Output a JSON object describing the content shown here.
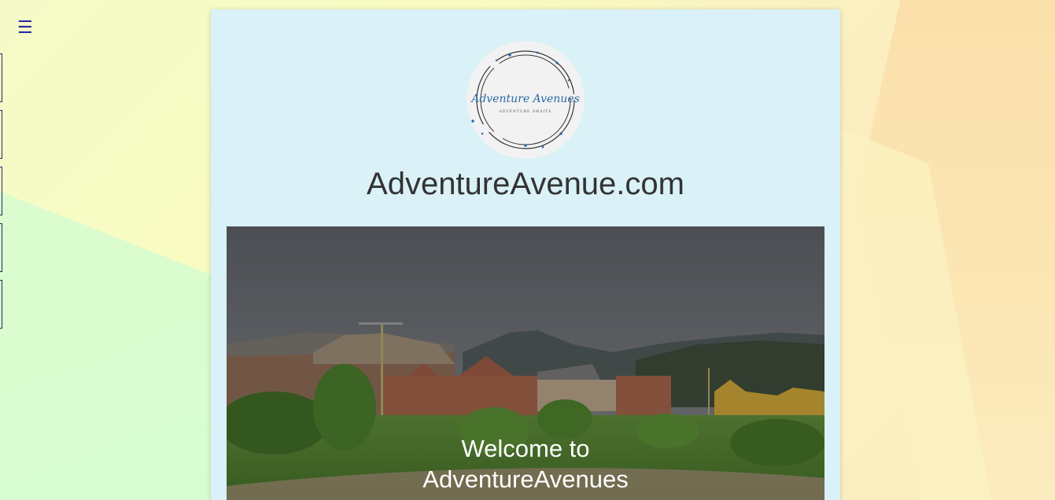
{
  "nav": {
    "menu_icon": "hamburger-icon",
    "menu_glyph": "☰",
    "slot_count": 5
  },
  "brand": {
    "logo_script_text": "Adventure Avenues",
    "logo_tagline": "ADVENTURE AWAITS",
    "site_title": "AdventureAvenue.com"
  },
  "hero": {
    "title_line1": "Welcome to",
    "title_line2": "AdventureAvenues"
  },
  "colors": {
    "accent": "#2a2aa0",
    "card_bg": "#d9f1f7",
    "logo_ink": "#2b6aa8"
  }
}
